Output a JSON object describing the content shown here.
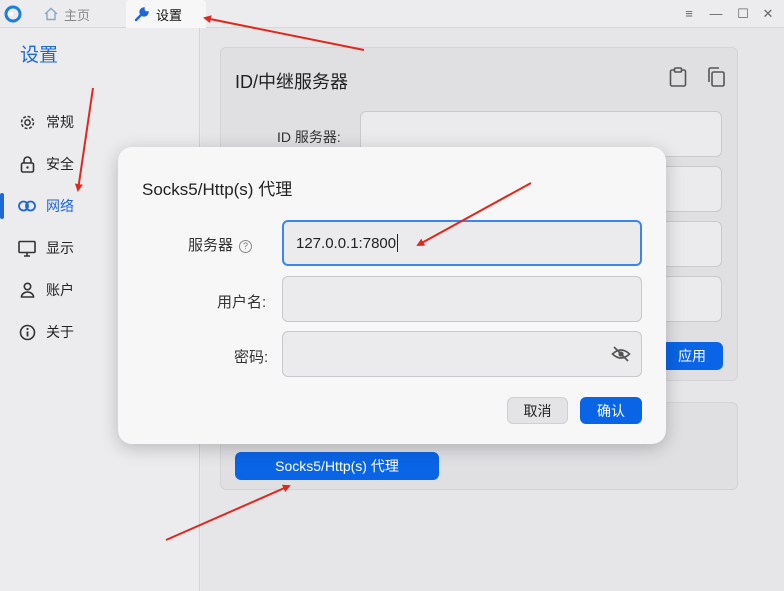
{
  "titlebar": {
    "tabs": [
      {
        "label": "主页",
        "icon": "home-icon"
      },
      {
        "label": "设置",
        "icon": "wrench-icon"
      }
    ],
    "controls": [
      "menu-icon",
      "minimize-icon",
      "maximize-icon",
      "close-icon"
    ]
  },
  "sidebar": {
    "title": "设置",
    "items": [
      {
        "label": "常规",
        "icon": "gear-icon"
      },
      {
        "label": "安全",
        "icon": "lock-icon"
      },
      {
        "label": "网络",
        "icon": "link-icon",
        "active": true
      },
      {
        "label": "显示",
        "icon": "monitor-icon"
      },
      {
        "label": "账户",
        "icon": "user-icon"
      },
      {
        "label": "关于",
        "icon": "info-icon"
      }
    ]
  },
  "main": {
    "server_card": {
      "title": "ID/中继服务器",
      "id_server_label": "ID 服务器:",
      "apply_label": "应用"
    },
    "proxy_button_label": "Socks5/Http(s) 代理"
  },
  "dialog": {
    "title": "Socks5/Http(s) 代理",
    "server_label": "服务器",
    "server_value": "127.0.0.1:7800",
    "username_label": "用户名:",
    "username_value": "",
    "password_label": "密码:",
    "password_value": "",
    "cancel_label": "取消",
    "ok_label": "确认"
  },
  "colors": {
    "accent": "#1e67d6",
    "button": "#0a64e6",
    "annotation_arrow": "#e0281e"
  }
}
